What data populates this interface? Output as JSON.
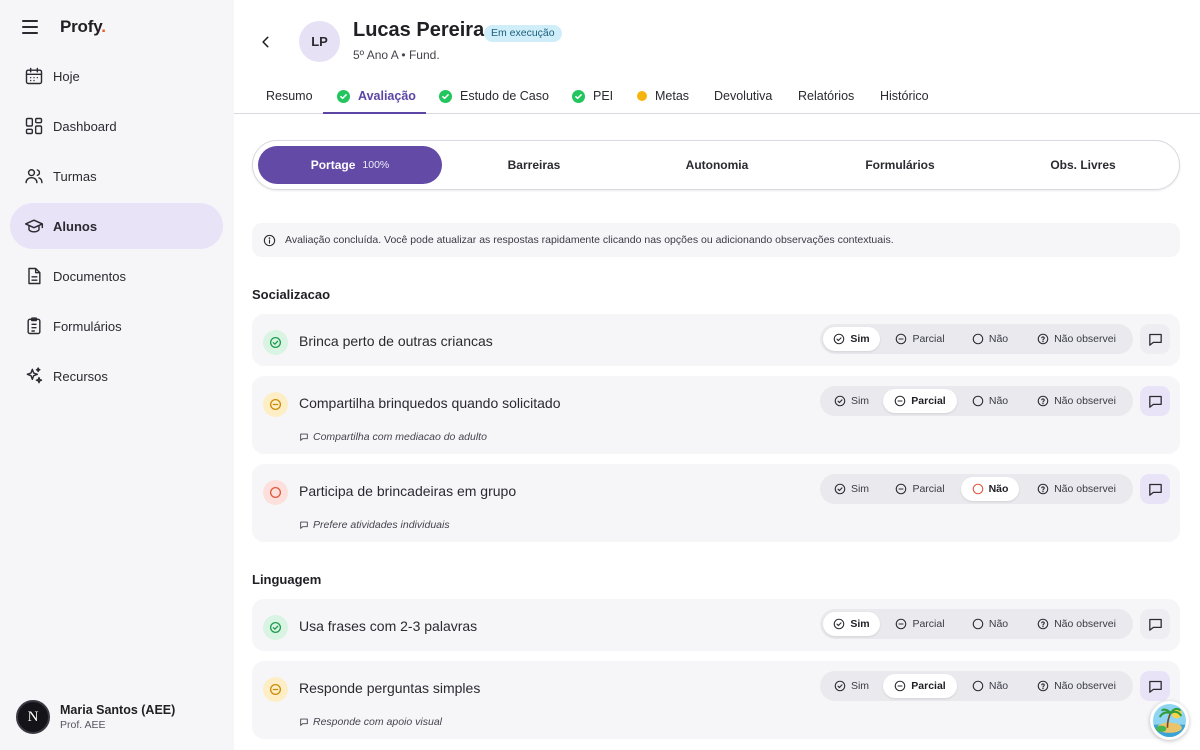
{
  "app": {
    "brand": "Profy",
    "brand_dot": "."
  },
  "sidebar": {
    "items": [
      {
        "label": "Hoje",
        "icon": "calendar-icon"
      },
      {
        "label": "Dashboard",
        "icon": "dashboard-icon"
      },
      {
        "label": "Turmas",
        "icon": "users-icon"
      },
      {
        "label": "Alunos",
        "icon": "graduation-cap-icon"
      },
      {
        "label": "Documentos",
        "icon": "document-icon"
      },
      {
        "label": "Formulários",
        "icon": "clipboard-icon"
      },
      {
        "label": "Recursos",
        "icon": "sparkles-icon"
      }
    ],
    "active": "Alunos",
    "user": {
      "initial": "N",
      "name": "Maria Santos (AEE)",
      "role": "Prof. AEE"
    }
  },
  "student": {
    "initials": "LP",
    "name": "Lucas Pereira",
    "status": "Em execução",
    "subtitle": "5º Ano A • Fund."
  },
  "tabs": [
    {
      "label": "Resumo",
      "state": "none"
    },
    {
      "label": "Avaliação",
      "state": "done",
      "active": true
    },
    {
      "label": "Estudo de Caso",
      "state": "done"
    },
    {
      "label": "PEI",
      "state": "done"
    },
    {
      "label": "Metas",
      "state": "pending"
    },
    {
      "label": "Devolutiva",
      "state": "none"
    },
    {
      "label": "Relatórios",
      "state": "none"
    },
    {
      "label": "Histórico",
      "state": "none"
    }
  ],
  "subtabs": [
    {
      "label": "Portage",
      "progress": "100%",
      "active": true
    },
    {
      "label": "Barreiras"
    },
    {
      "label": "Autonomia"
    },
    {
      "label": "Formulários"
    },
    {
      "label": "Obs. Livres"
    }
  ],
  "info_message": "Avaliação concluída. Você pode atualizar as respostas rapidamente clicando nas opções ou adicionando observações contextuais.",
  "options": [
    "Sim",
    "Parcial",
    "Não",
    "Não observei"
  ],
  "sections": [
    {
      "title": "Socializacao",
      "questions": [
        {
          "text": "Brinca perto de outras criancas",
          "answer": "Sim",
          "note": ""
        },
        {
          "text": "Compartilha brinquedos quando solicitado",
          "answer": "Parcial",
          "note": "Compartilha com mediacao do adulto"
        },
        {
          "text": "Participa de brincadeiras em grupo",
          "answer": "Não",
          "note": "Prefere atividades individuais"
        }
      ]
    },
    {
      "title": "Linguagem",
      "questions": [
        {
          "text": "Usa frases com 2-3 palavras",
          "answer": "Sim",
          "note": ""
        },
        {
          "text": "Responde perguntas simples",
          "answer": "Parcial",
          "note": "Responde com apoio visual"
        }
      ]
    }
  ],
  "colors": {
    "accent": "#5c45a5",
    "success": "#22c55e",
    "warning": "#f6b40f",
    "danger": "#e2553f",
    "badge_bg": "#cfeefa"
  }
}
